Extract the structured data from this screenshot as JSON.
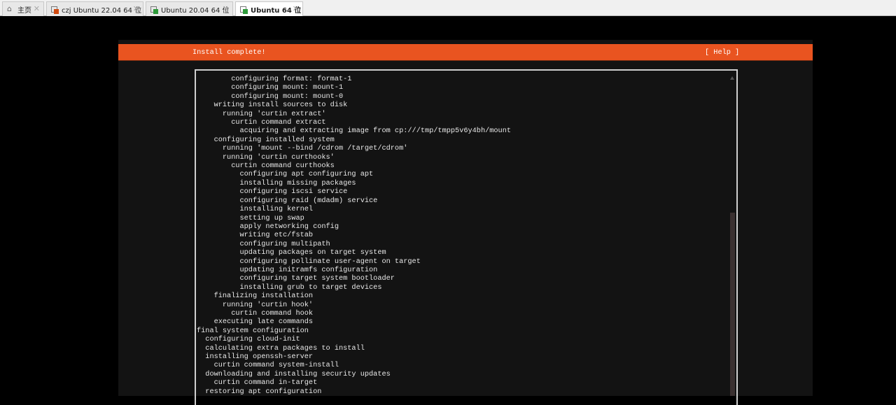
{
  "tabs": [
    {
      "label": "主页",
      "icon": "home-icon",
      "active": false
    },
    {
      "label": "czj Ubuntu 22.04 64 位",
      "icon": "vm-icon",
      "active": false
    },
    {
      "label": "Ubuntu 20.04  64 位",
      "icon": "vm-icon",
      "active": false
    },
    {
      "label": "Ubuntu 64 位",
      "icon": "vm-icon",
      "active": true
    }
  ],
  "header": {
    "title": "Install complete!",
    "help": "[ Help ]"
  },
  "log": [
    {
      "indent": 8,
      "text": "configuring format: format-1"
    },
    {
      "indent": 8,
      "text": "configuring mount: mount-1"
    },
    {
      "indent": 8,
      "text": "configuring mount: mount-0"
    },
    {
      "indent": 4,
      "text": "writing install sources to disk"
    },
    {
      "indent": 6,
      "text": "running 'curtin extract'"
    },
    {
      "indent": 8,
      "text": "curtin command extract"
    },
    {
      "indent": 10,
      "text": "acquiring and extracting image from cp:///tmp/tmpp5v6y4bh/mount"
    },
    {
      "indent": 4,
      "text": "configuring installed system"
    },
    {
      "indent": 6,
      "text": "running 'mount --bind /cdrom /target/cdrom'"
    },
    {
      "indent": 6,
      "text": "running 'curtin curthooks'"
    },
    {
      "indent": 8,
      "text": "curtin command curthooks"
    },
    {
      "indent": 10,
      "text": "configuring apt configuring apt"
    },
    {
      "indent": 10,
      "text": "installing missing packages"
    },
    {
      "indent": 10,
      "text": "configuring iscsi service"
    },
    {
      "indent": 10,
      "text": "configuring raid (mdadm) service"
    },
    {
      "indent": 10,
      "text": "installing kernel"
    },
    {
      "indent": 10,
      "text": "setting up swap"
    },
    {
      "indent": 10,
      "text": "apply networking config"
    },
    {
      "indent": 10,
      "text": "writing etc/fstab"
    },
    {
      "indent": 10,
      "text": "configuring multipath"
    },
    {
      "indent": 10,
      "text": "updating packages on target system"
    },
    {
      "indent": 10,
      "text": "configuring pollinate user-agent on target"
    },
    {
      "indent": 10,
      "text": "updating initramfs configuration"
    },
    {
      "indent": 10,
      "text": "configuring target system bootloader"
    },
    {
      "indent": 10,
      "text": "installing grub to target devices"
    },
    {
      "indent": 4,
      "text": "finalizing installation"
    },
    {
      "indent": 6,
      "text": "running 'curtin hook'"
    },
    {
      "indent": 8,
      "text": "curtin command hook"
    },
    {
      "indent": 4,
      "text": "executing late commands"
    },
    {
      "indent": 0,
      "text": "final system configuration"
    },
    {
      "indent": 2,
      "text": "configuring cloud-init"
    },
    {
      "indent": 2,
      "text": "calculating extra packages to install"
    },
    {
      "indent": 2,
      "text": "installing openssh-server"
    },
    {
      "indent": 4,
      "text": "curtin command system-install"
    },
    {
      "indent": 2,
      "text": "downloading and installing security updates"
    },
    {
      "indent": 4,
      "text": "curtin command in-target"
    },
    {
      "indent": 2,
      "text": "restoring apt configuration"
    }
  ]
}
